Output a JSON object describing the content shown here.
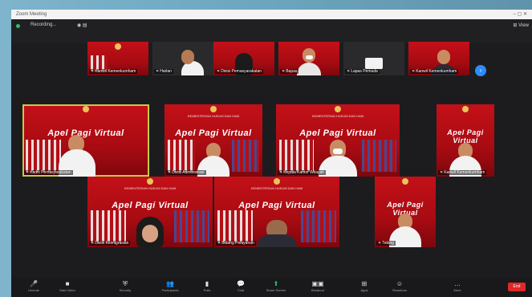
{
  "window": {
    "title": "Zoom Meeting",
    "controls": "– ▢ ✕"
  },
  "topbar": {
    "recording_label": "Recording...",
    "icons_text": "◉ ▤",
    "view_label": "⊞ View"
  },
  "colors": {
    "banner_red": "#b80d14",
    "active_outline": "#c6c94a",
    "page_button": "#2d8cff",
    "end_button": "#e02828"
  },
  "banner": {
    "headline": "Apel Pagi Virtual",
    "subheading": "KEMENTERIAN HUKUM DAN HAM"
  },
  "strip": [
    {
      "name": "Kanwil Kemenkumham"
    },
    {
      "name": "Harlan"
    },
    {
      "name": "Divisi Pemasyarakatan"
    },
    {
      "name": "Bapas"
    },
    {
      "name": "Lapas Pemuda"
    },
    {
      "name": "Kanwil Kemenkumham"
    }
  ],
  "grid": [
    {
      "name": "Kadiv Pemasyarakatan"
    },
    {
      "name": "Divisi Administrasi"
    },
    {
      "name": "Kepala Kantor Wilayah"
    },
    {
      "name": "Kanwil Kemenkumham"
    },
    {
      "name": "Divisi Keimigrasian"
    },
    {
      "name": "Bidang Pelayanan"
    },
    {
      "name": "Tebing"
    }
  ],
  "page_next_icon": "›",
  "toolbar": {
    "items": [
      {
        "icon": "🎤",
        "label": "Unmute"
      },
      {
        "icon": "■",
        "label": "Start Video"
      },
      {
        "icon": "⛨",
        "label": "Security"
      },
      {
        "icon": "👥",
        "label": "Participants"
      },
      {
        "icon": "▮",
        "label": "Polls"
      },
      {
        "icon": "💬",
        "label": "Chat"
      },
      {
        "icon": "⬆",
        "label": "Share Screen"
      },
      {
        "icon": "▣▣",
        "label": "Breakout"
      },
      {
        "icon": "⊞",
        "label": "Apps"
      },
      {
        "icon": "☺",
        "label": "Reactions"
      },
      {
        "icon": "…",
        "label": "More"
      }
    ],
    "end_label": "End"
  }
}
